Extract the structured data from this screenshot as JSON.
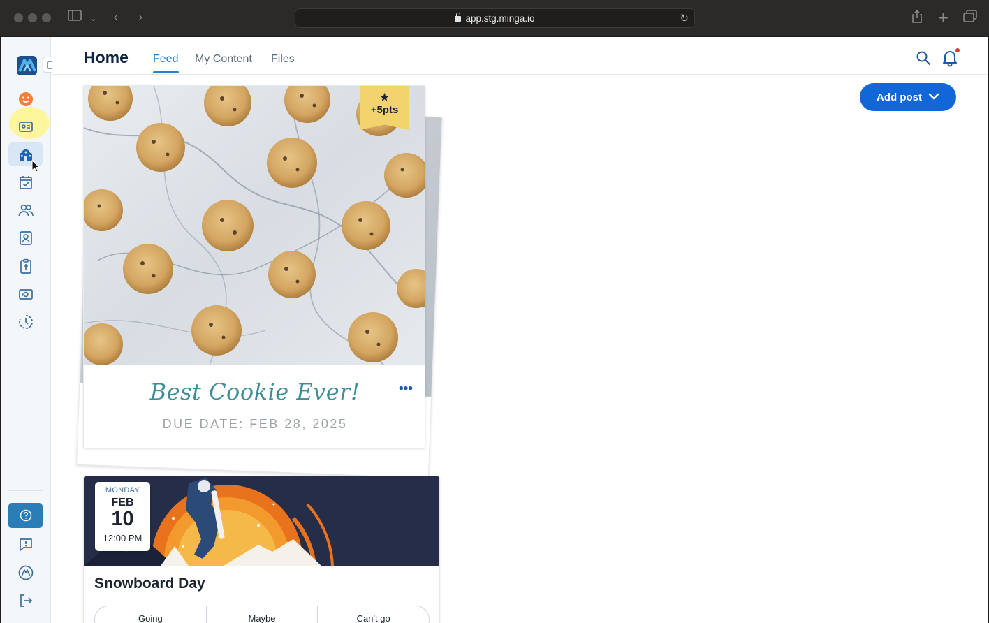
{
  "browser": {
    "url": "app.stg.minga.io"
  },
  "header": {
    "title": "Home",
    "tabs": [
      {
        "label": "Feed",
        "active": true
      },
      {
        "label": "My Content",
        "active": false
      },
      {
        "label": "Files",
        "active": false
      }
    ]
  },
  "sidebar": {
    "items": [
      {
        "icon": "smiley-icon"
      },
      {
        "icon": "id-card-icon"
      },
      {
        "icon": "school-icon",
        "active": true
      },
      {
        "icon": "calendar-check-icon"
      },
      {
        "icon": "people-icon"
      },
      {
        "icon": "contact-icon"
      },
      {
        "icon": "clipboard-icon"
      },
      {
        "icon": "ticket-icon"
      },
      {
        "icon": "progress-icon"
      }
    ],
    "bottom": [
      {
        "icon": "help-icon"
      },
      {
        "icon": "feedback-icon"
      },
      {
        "icon": "minga-logo-icon"
      },
      {
        "icon": "logout-icon"
      }
    ]
  },
  "actions": {
    "add_post_label": "Add post"
  },
  "cookie_card": {
    "badge_points": "+5pts",
    "title": "Best Cookie Ever!",
    "due": "DUE DATE: FEB 28, 2025"
  },
  "event_card": {
    "weekday": "MONDAY",
    "month": "FEB",
    "day": "10",
    "time": "12:00 PM",
    "title": "Snowboard Day",
    "rsvp": [
      "Going",
      "Maybe",
      "Can't go"
    ]
  },
  "colors": {
    "accent": "#1167d8",
    "tab_active": "#2a82c6",
    "title_dark": "#12233f",
    "badge": "#f3d36e",
    "card_title": "#3f8d97",
    "notification_dot": "#e5322d"
  }
}
